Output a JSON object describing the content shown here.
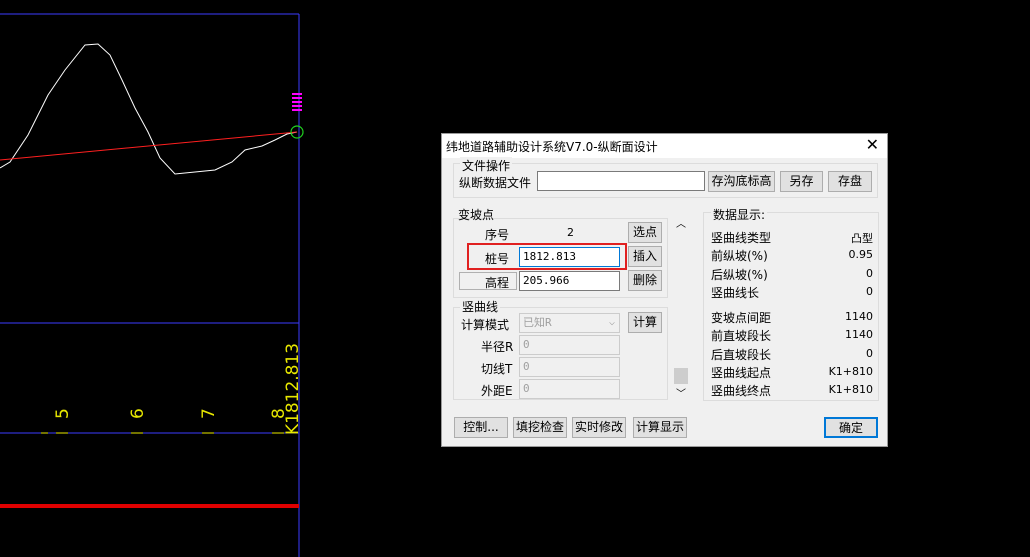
{
  "cad": {
    "markers": [
      "5",
      "6",
      "7",
      "8"
    ],
    "vertical_label": "K1812.813"
  },
  "dialog": {
    "title": "纬地道路辅助设计系统V7.0-纵断面设计",
    "close_glyph": "✕",
    "file_group": {
      "legend": "文件操作",
      "file_label": "纵断数据文件",
      "file_value": "",
      "save_bottom_label": "存沟底标高",
      "save_as_label": "另存",
      "save_label": "存盘"
    },
    "vpi_group": {
      "legend": "变坡点",
      "index_label": "序号",
      "index_value": "2",
      "select_label": "选点",
      "station_label": "桩号",
      "station_value": "1812.813",
      "insert_label": "插入",
      "elevation_label": "高程",
      "elevation_value": "205.966",
      "delete_label": "删除"
    },
    "curve_group": {
      "legend": "竖曲线",
      "mode_label": "计算模式",
      "mode_value": "已知R",
      "compute_label": "计算",
      "radius_label": "半径R",
      "radius_value": "0",
      "tangent_label": "切线T",
      "tangent_value": "0",
      "external_label": "外距E",
      "external_value": "0"
    },
    "data_display": {
      "legend": "数据显示:",
      "rows": [
        {
          "label": "竖曲线类型",
          "value": "凸型"
        },
        {
          "label": "前纵坡(%)",
          "value": "0.95"
        },
        {
          "label": "后纵坡(%)",
          "value": "0"
        },
        {
          "label": "竖曲线长",
          "value": "0"
        },
        {
          "label": "变坡点间距",
          "value": "1140"
        },
        {
          "label": "前直坡段长",
          "value": "1140"
        },
        {
          "label": "后直坡段长",
          "value": "0"
        },
        {
          "label": "竖曲线起点",
          "value": "K1+810"
        },
        {
          "label": "竖曲线终点",
          "value": "K1+810"
        }
      ]
    },
    "bottom_buttons": {
      "control": "控制...",
      "fill_cut": "填挖检查",
      "realtime": "实时修改",
      "compute_display": "计算显示",
      "ok": "确定"
    }
  }
}
